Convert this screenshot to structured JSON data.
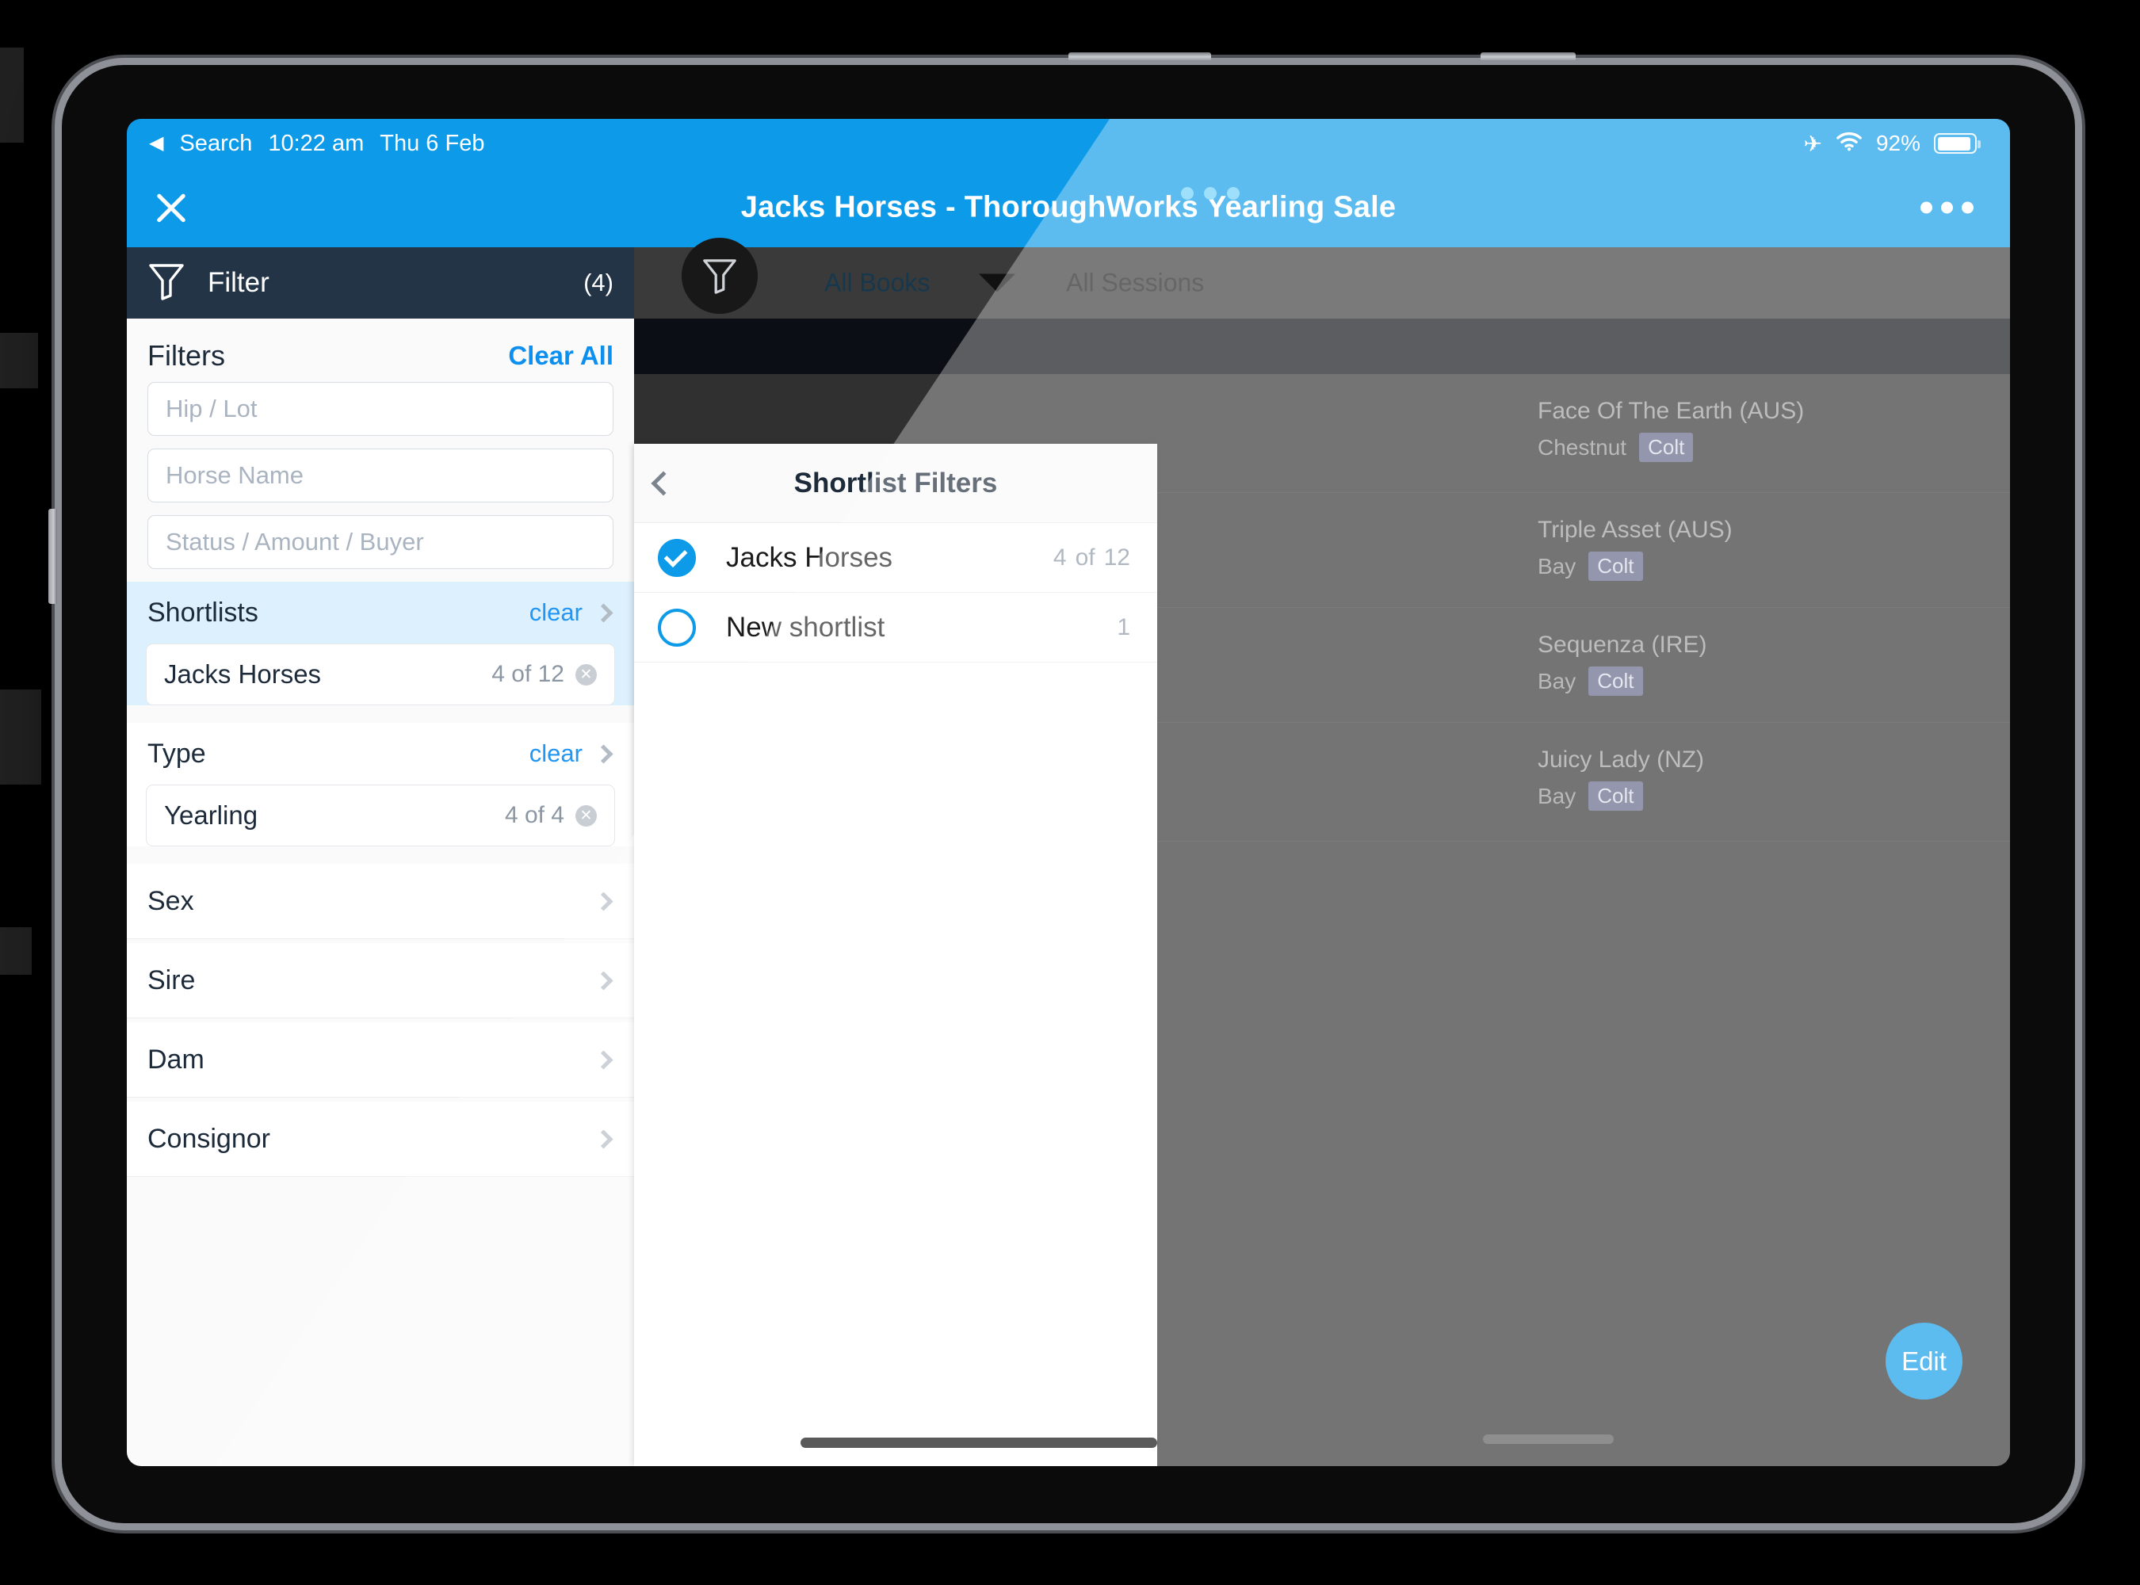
{
  "status_bar": {
    "back_label": "Search",
    "back_icon": "triangle-left-icon",
    "time": "10:22 am",
    "date": "Thu 6 Feb",
    "airplane_icon": "airplane-icon",
    "wifi_icon": "wifi-icon",
    "battery_percent": "92%",
    "battery_icon": "battery-icon"
  },
  "navbar": {
    "close_icon": "close-icon",
    "title": "Jacks Horses - ThoroughWorks Yearling Sale",
    "more_icon": "more-options-icon",
    "accent": "#0d9ae8"
  },
  "toolbar": {
    "filter_icon": "funnel-icon",
    "books_label": "All Books",
    "caret_icon": "chevron-down-icon",
    "sessions_label": "All Sessions"
  },
  "filter_panel": {
    "header": {
      "icon": "funnel-icon",
      "title": "Filter",
      "count": "(4)",
      "bg": "#243447"
    },
    "filters_label": "Filters",
    "clear_all_label": "Clear All",
    "fields": [
      {
        "name": "hip-lot",
        "placeholder": "Hip / Lot",
        "value": ""
      },
      {
        "name": "horse-name",
        "placeholder": "Horse Name",
        "value": ""
      },
      {
        "name": "status-amount-buyer",
        "placeholder": "Status / Amount / Buyer",
        "value": ""
      }
    ],
    "groups": [
      {
        "name": "Shortlists",
        "clear_label": "clear",
        "active": true,
        "selected": [
          {
            "label": "Jacks Horses",
            "count": "4 of 12"
          }
        ]
      },
      {
        "name": "Type",
        "clear_label": "clear",
        "active": false,
        "selected": [
          {
            "label": "Yearling",
            "count": "4 of 4"
          }
        ]
      }
    ],
    "simple_rows": [
      {
        "label": "Sex"
      },
      {
        "label": "Sire"
      },
      {
        "label": "Dam"
      },
      {
        "label": "Consignor"
      }
    ]
  },
  "shortlist_panel": {
    "back_icon": "chevron-left-icon",
    "title": "Shortlist Filters",
    "rows": [
      {
        "label": "Jacks Horses",
        "selected": true,
        "count_num": "4",
        "count_of": "of",
        "count_total": "12"
      },
      {
        "label": "New shortlist",
        "selected": false,
        "count_num": "1",
        "count_of": "",
        "count_total": ""
      }
    ]
  },
  "background_list": {
    "rows": [
      {
        "name": "Face Of The Earth (AUS)",
        "colour": "Chestnut",
        "sex": "Colt"
      },
      {
        "name": "Triple Asset (AUS)",
        "colour": "Bay",
        "sex": "Colt"
      },
      {
        "name": "Sequenza (IRE)",
        "colour": "Bay",
        "sex": "Colt"
      },
      {
        "name": "Juicy Lady (NZ)",
        "colour": "Bay",
        "sex": "Colt"
      }
    ],
    "edit_button": "Edit"
  }
}
